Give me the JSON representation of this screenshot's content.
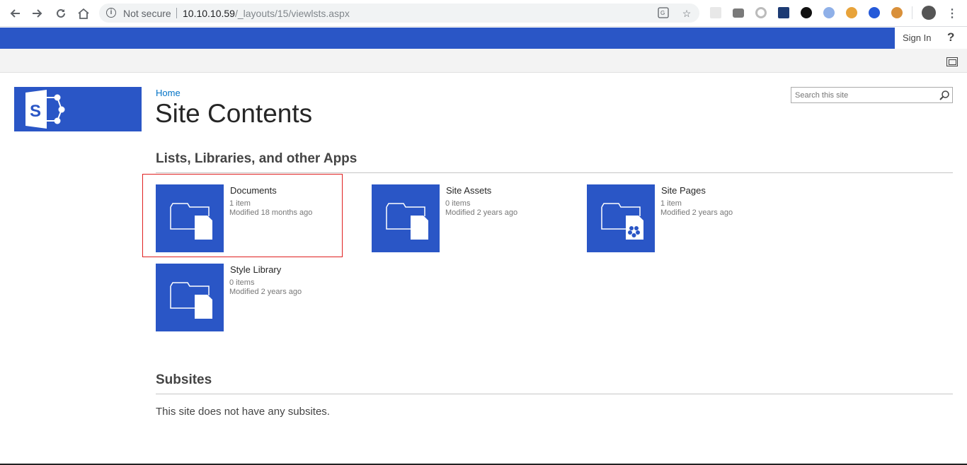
{
  "browser": {
    "security_label": "Not secure",
    "url_host": "10.10.10.59",
    "url_path": "/_layouts/15/viewlsts.aspx"
  },
  "suitebar": {
    "accent": "#2a56c6",
    "signin_label": "Sign In",
    "help_label": "?"
  },
  "header": {
    "breadcrumb": "Home",
    "title": "Site Contents",
    "search_placeholder": "Search this site"
  },
  "apps_section": {
    "title": "Lists, Libraries, and other Apps",
    "tiles": [
      {
        "name": "Documents",
        "count": "1 item",
        "modified": "Modified 18 months ago",
        "icon": "document-library-icon"
      },
      {
        "name": "Site Assets",
        "count": "0 items",
        "modified": "Modified 2 years ago",
        "icon": "document-library-icon"
      },
      {
        "name": "Site Pages",
        "count": "1 item",
        "modified": "Modified 2 years ago",
        "icon": "wiki-page-library-icon"
      },
      {
        "name": "Style Library",
        "count": "0 items",
        "modified": "Modified 2 years ago",
        "icon": "document-library-icon"
      }
    ]
  },
  "subsites_section": {
    "title": "Subsites",
    "empty_text": "This site does not have any subsites."
  }
}
